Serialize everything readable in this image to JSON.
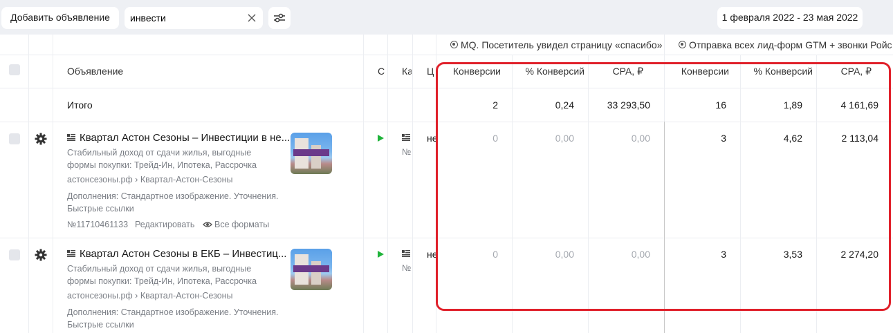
{
  "toolbar": {
    "add_ad_label": "Добавить объявление",
    "search_value": "инвести",
    "date_range": "1 февраля 2022 - 23 мая 2022"
  },
  "table": {
    "goal_groups": [
      "MQ. Посетитель увидел страницу «спасибо»",
      "Отправка всех лид-форм GTM + звонки Ройстат"
    ],
    "columns": {
      "ad": "Объявление",
      "c_trunc": "С",
      "k_trunc": "Ка",
      "ts_trunc": "Ц",
      "metrics": [
        "Конверсии",
        "% Конверсий",
        "CPA, ₽",
        "Конверсии",
        "% Конверсий",
        "CPA, ₽"
      ]
    },
    "totals": {
      "label": "Итого",
      "values": [
        "2",
        "0,24",
        "33 293,50",
        "16",
        "1,89",
        "4 161,69"
      ]
    },
    "rows": [
      {
        "title": "Квартал Астон Сезоны – Инвестиции в не...",
        "text": "Стабильный доход от сдачи жилья, выгодные формы покупки: Трейд-Ин, Ипотека, Рассрочка",
        "url": "астонсезоны.рф › Квартал-Астон-Сезоны",
        "extras": "Дополнения: Стандартное изображение. Уточнения. Быстрые ссылки",
        "id": "№11710461133",
        "edit": "Редактировать",
        "formats": "Все форматы",
        "k_no": "№",
        "ts_trunc": "не",
        "values": [
          "0",
          "0,00",
          "0,00",
          "3",
          "4,62",
          "2 113,04"
        ]
      },
      {
        "title": "Квартал Астон Сезоны в ЕКБ – Инвестиц...",
        "text": "Стабильный доход от сдачи жилья, выгодные формы покупки: Трейд-Ин, Ипотека, Рассрочка",
        "url": "астонсезоны.рф › Квартал-Астон-Сезоны",
        "extras": "Дополнения: Стандартное изображение. Уточнения. Быстрые ссылки",
        "k_no": "№",
        "ts_trunc": "не",
        "values": [
          "0",
          "0,00",
          "0,00",
          "3",
          "3,53",
          "2 274,20"
        ]
      }
    ]
  },
  "colors": {
    "highlight_border": "#e0202a",
    "status_active": "#1fb33a",
    "page_bg": "#eef0f4"
  }
}
